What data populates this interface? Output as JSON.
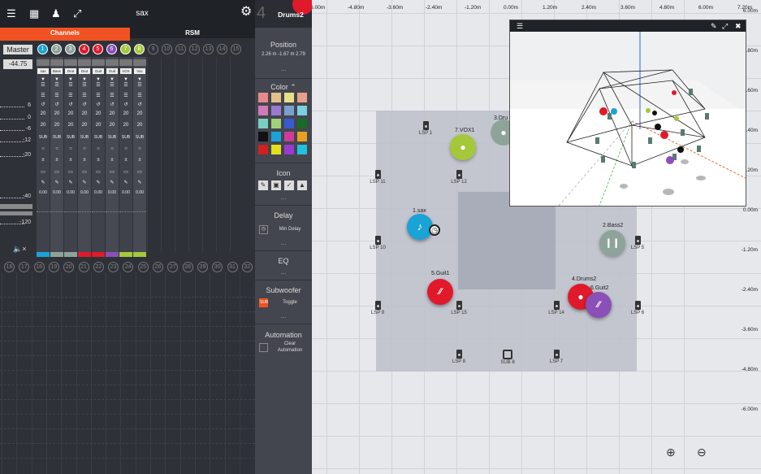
{
  "topbar": {
    "menu_icon": "menu-icon",
    "save_icon": "save-icon",
    "user_icon": "user-icon",
    "expand_icon": "expand-icon",
    "title": "sax",
    "settings_icon": "gear-icon"
  },
  "tabs": {
    "channels": "Channels",
    "rsm": "RSM"
  },
  "master": {
    "label": "Master",
    "value": "-44.75"
  },
  "db_scale": [
    "6",
    "0",
    "-6",
    "-12",
    "-20",
    "-40",
    "-120"
  ],
  "channel_numbers_top": [
    "1",
    "2",
    "3",
    "4",
    "5",
    "6",
    "7",
    "8",
    "9",
    "10",
    "11",
    "12",
    "13",
    "14",
    "15"
  ],
  "channel_numbers_bottom": [
    "16",
    "17",
    "18",
    "19",
    "20",
    "21",
    "22",
    "23",
    "24",
    "25",
    "26",
    "27",
    "28",
    "29",
    "30",
    "31",
    "32"
  ],
  "channels": [
    {
      "num": "1",
      "name": "sax",
      "color": "#1aa3d6",
      "value_a": "20",
      "sub": "SUB",
      "zero": "0.00"
    },
    {
      "num": "2",
      "name": "Bass",
      "color": "#8ea39a",
      "value_a": "20",
      "sub": "SUB",
      "zero": "0.00"
    },
    {
      "num": "3",
      "name": "Drut",
      "color": "#8ea39a",
      "value_a": "20",
      "sub": "SUB",
      "zero": "0.00"
    },
    {
      "num": "4",
      "name": "Drut",
      "color": "#e01a2b",
      "value_a": "20",
      "sub": "SUB",
      "zero": "0.00"
    },
    {
      "num": "5",
      "name": "Guit",
      "color": "#e01a2b",
      "value_a": "20",
      "sub": "SUB",
      "zero": "0.00"
    },
    {
      "num": "6",
      "name": "Guit",
      "color": "#8b4fb8",
      "value_a": "20",
      "sub": "SUB",
      "zero": "0.00"
    },
    {
      "num": "7",
      "name": "VOX",
      "color": "#a4c83a",
      "value_a": "20",
      "sub": "SUB",
      "zero": "0.00"
    },
    {
      "num": "8",
      "name": "Voc",
      "color": "#a4c83a",
      "value_a": "20",
      "sub": "SUB",
      "zero": "0.00"
    }
  ],
  "mute_icon": "speaker-mute-icon",
  "properties": {
    "number": "4",
    "name": "Drums2",
    "position_title": "Position",
    "position_value": "2.26 m -1.67 m 2.79",
    "more": "...",
    "color_title": "Color",
    "icon_title": "Icon",
    "delay_title": "Delay",
    "delay_label": "Min Delay",
    "eq_title": "EQ",
    "subwoofer_title": "Subwoofer",
    "subwoofer_label": "Toggle",
    "subwoofer_tag": "SUB",
    "automation_title": "Automation",
    "automation_label_1": "Clear",
    "automation_label_2": "Automation",
    "swatches": [
      "#e68a8a",
      "#e6c08a",
      "#e6e08a",
      "#e6a08a",
      "#d07ab8",
      "#9a7ad0",
      "#7aa0d0",
      "#7ad0e0",
      "#7ad0c0",
      "#a0d07a",
      "#3a5ad0",
      "#1a6a2a",
      "#111111",
      "#1aa3d6",
      "#d03a9a",
      "#e8a020",
      "#d02020",
      "#e0e020",
      "#9a3ad0",
      "#20c0e0"
    ]
  },
  "stage": {
    "x_ticks": [
      "-6.00m",
      "-4.80m",
      "-3.60m",
      "-2.40m",
      "-1.20m",
      "0.00m",
      "1.20m",
      "2.40m",
      "3.60m",
      "4.80m",
      "6.00m",
      "7.20m"
    ],
    "y_ticks": [
      "6.00m",
      "4.80m",
      "3.60m",
      "2.40m",
      "1.20m",
      "0.00m",
      "-1.20m",
      "-2.40m",
      "-3.60m",
      "-4.80m",
      "-6.00m"
    ],
    "y_tick_prefix": "",
    "speakers": [
      {
        "label": "LSP 1"
      },
      {
        "label": "LSP 11"
      },
      {
        "label": "LSP 12"
      },
      {
        "label": "LSP 10"
      },
      {
        "label": "LSP 5"
      },
      {
        "label": "LSP 9"
      },
      {
        "label": "LSP 15"
      },
      {
        "label": "LSP 14"
      },
      {
        "label": "LSP 6"
      },
      {
        "label": "LSP 8"
      },
      {
        "label": "LSP 7"
      }
    ],
    "sub_label": "SUB 8",
    "sources": [
      {
        "label": "1.sax",
        "color": "#1aa3d6"
      },
      {
        "label": "2.Bass2",
        "color": "#8ea39a"
      },
      {
        "label": "3.Dru",
        "color": "#8ea39a"
      },
      {
        "label": "7.VOX1",
        "color": "#a4c83a"
      },
      {
        "label": "5.Guit1",
        "color": "#e01a2b"
      },
      {
        "label": "4.Drums2",
        "color": "#e01a2b"
      },
      {
        "label": "6.Guit2",
        "color": "#8b4fb8"
      }
    ],
    "zoom_in_icon": "zoom-in-icon",
    "zoom_out_icon": "zoom-out-icon"
  },
  "view3d": {
    "menu_icon": "menu-icon",
    "edit_icon": "pencil-icon",
    "fullscreen_icon": "fullscreen-icon",
    "close_icon": "close-icon"
  }
}
